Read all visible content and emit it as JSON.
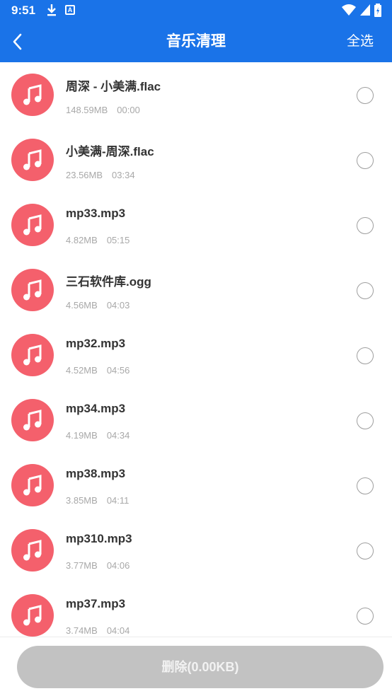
{
  "status_bar": {
    "time": "9:51",
    "icons": [
      "download-icon",
      "a-icon",
      "wifi-icon",
      "signal-icon",
      "battery-icon"
    ]
  },
  "app_bar": {
    "title": "音乐清理",
    "back_icon": "chevron-left-icon",
    "select_all_label": "全选"
  },
  "colors": {
    "primary": "#1a73e8",
    "music_icon_bg": "#f4606c",
    "button_disabled": "#c2c2c2"
  },
  "files": [
    {
      "name": "周深 - 小美满.flac",
      "size": "148.59MB",
      "duration": "00:00"
    },
    {
      "name": "小美满-周深.flac",
      "size": "23.56MB",
      "duration": "03:34"
    },
    {
      "name": "mp33.mp3",
      "size": "4.82MB",
      "duration": "05:15"
    },
    {
      "name": "三石软件库.ogg",
      "size": "4.56MB",
      "duration": "04:03"
    },
    {
      "name": "mp32.mp3",
      "size": "4.52MB",
      "duration": "04:56"
    },
    {
      "name": "mp34.mp3",
      "size": "4.19MB",
      "duration": "04:34"
    },
    {
      "name": "mp38.mp3",
      "size": "3.85MB",
      "duration": "04:11"
    },
    {
      "name": "mp310.mp3",
      "size": "3.77MB",
      "duration": "04:06"
    },
    {
      "name": "mp37.mp3",
      "size": "3.74MB",
      "duration": "04:04"
    }
  ],
  "footer": {
    "delete_label": "删除(0.00KB)"
  }
}
